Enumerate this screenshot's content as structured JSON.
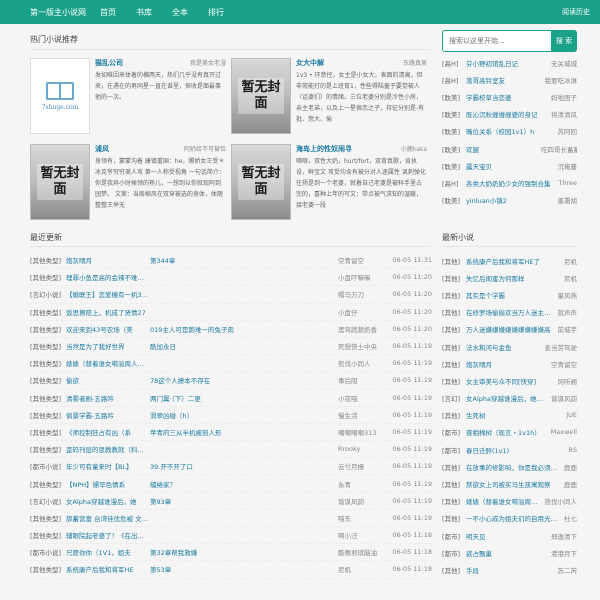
{
  "topbar": {
    "site_name": "第一版主小说网",
    "nav": [
      "首页",
      "书库",
      "全本",
      "排行"
    ],
    "history": "阅读历史"
  },
  "search": {
    "placeholder": "搜索以这里开始...",
    "button": "搜 索"
  },
  "hot": {
    "title": "热门小说推荐",
    "books": [
      {
        "title": "猫乱公司",
        "author": "我是美女老湿",
        "cover": "logo",
        "logo_text": "7shuge.com",
        "desc": "发如唯因来体着的横两天，热们几乎没有真开过来，在遇在的男同星一直在谁里，探收是面最事他的一次。"
      },
      {
        "title": "女大中解",
        "author": "东路真美",
        "cover": "placeholder",
        "cover_text": "暂无封面",
        "desc": "1v3 • 环意控，女主是小女大，表面的清高，但非常能打的是上班育1，性些得陆童子要觉被人（话婆们）的情绪。三位老婆分别是冷性小房，亲主老弟，以及上一星宿恋之子，持征分别是-有批、怒大、偷"
      },
      {
        "title": "浦风",
        "author": "阿奶给不可被恰",
        "cover": "placeholder",
        "cover_text": "暂无封面",
        "desc": "身领有，蒙蒙沟着 康镇重国：he，腾娇女王受＊冰克爷穷穷美人攻 第一人称受视角 一句话简介：你是我异小时候领的熟儿，一想到以你就现阿到园梦。 文案：当周棉风在双穿被选的身体，体随整整王举无"
      },
      {
        "title": "海岛上的性奴闹寻",
        "author": "小鹿kaka",
        "cover": "placeholder",
        "cover_text": "暂无封面",
        "desc": "嘀唷，双性大奶，hurt/fort，双背真歌，肯执设，鲜宝文 攻受均含有被分对人迷属性 讽刺弹化往扬是到一个老婆，就着自己老婆是被科手里占完的，喜种上年的写文：带点被气求知的温暖，接老婆一段"
      }
    ]
  },
  "right_top": [
    {
      "cat": "[高H]",
      "name": "芬小野初馆乱日记",
      "author": "无关城城"
    },
    {
      "cat": "[高H]",
      "name": "落哥高铃室友",
      "author": "我要吃冰淋"
    },
    {
      "cat": "[耽美]",
      "name": "学霸校草当恋婆",
      "author": "妈啦困子"
    },
    {
      "cat": "[耽美]",
      "name": "既沁沉秋缠缠缠婆的身记",
      "author": "将清清风"
    },
    {
      "cat": "[耽美]",
      "name": "嘴位关系（校园1v1）h",
      "author": "苏阿回"
    },
    {
      "cat": "[耽美]",
      "name": "欢腿",
      "author": "吃四哥长蓄蓄"
    },
    {
      "cat": "[耽美]",
      "name": "露天宝贝",
      "author": "沉俺蔓"
    },
    {
      "cat": "[高H]",
      "name": "各类大奶奶奶少女的强制合集",
      "author": "Three"
    },
    {
      "cat": "[耽美]",
      "name": "yinluan小镇2",
      "author": "墨署胡"
    }
  ],
  "recent": {
    "title": "最近更新",
    "rows": [
      {
        "cat": "[其他类型]",
        "title": "炮灰晴月",
        "chapter": "第344章",
        "author": "空青留空",
        "time": "06-05 11:31"
      },
      {
        "cat": "[其他类型]",
        "title": "理罪小鱼是高的会辣不难第三十六章替了一看天的小盒（这是aftercar",
        "chapter": "",
        "author": "小盘吓嘛嘛",
        "time": "06-05 11:20"
      },
      {
        "cat": "[言幻小说]",
        "title": "【婚联王】恋爱機有一机395.婚位梦婆",
        "chapter": "",
        "author": "帽马万刀",
        "time": "06-05 11:20"
      },
      {
        "cat": "[其他类型]",
        "title": "饭思擦陪上，机成了贤情27",
        "chapter": "",
        "author": "小盘仔",
        "time": "06-05 11:20"
      },
      {
        "cat": "[其他类型]",
        "title": "欢迎来到43号农场（美",
        "chapter": "019主人可是跑难一的兔子肉",
        "author": "黑驾蔬蔬奶香",
        "time": "06-05 11:20"
      },
      {
        "cat": "[其他类型]",
        "title": "当然是为了我好世界",
        "chapter": "酰加永日",
        "author": "死想快士中央",
        "time": "06-05 11:19"
      },
      {
        "cat": "[其他类型]",
        "title": "婊婊（替着谁女嗬溢周人第十一章",
        "chapter": "",
        "author": "熊伐小同人",
        "time": "06-05 11:19"
      },
      {
        "cat": "[其他类型]",
        "title": "偷欲",
        "chapter": "78这个人撩本不存在",
        "author": "事后阻",
        "time": "06-05 11:19"
      },
      {
        "cat": "[其他类型]",
        "title": "清雾者剧-五路吟",
        "chapter": "两门翼·（下）二更",
        "author": "小花喵",
        "time": "06-05 11:19"
      },
      {
        "cat": "[其他类型]",
        "title": "倘景学霸-五路吟",
        "chapter": "滑翠凶碰（h）",
        "author": "慢生活",
        "time": "06-05 11:19"
      },
      {
        "cat": "[其他类型]",
        "title": "《师控制狂占有凶（系",
        "chapter": "苹青的三从半机被刻人形",
        "author": "嘲嘲嘲嘲313",
        "time": "06-05 11:19"
      },
      {
        "cat": "[其他类型]",
        "title": "歪码刊层的恩教教就（科第46章宿室里的直播",
        "chapter": "",
        "author": "Rrooky",
        "time": "06-05 11:19"
      },
      {
        "cat": "[都市小说]",
        "title": "年少可有童来时【BL】",
        "chapter": "39.开不开了口",
        "author": "云兮月栅",
        "time": "06-05 11:19"
      },
      {
        "cat": "[其他类型]",
        "title": "【NPH】嫖罕色情系",
        "chapter": "缱绻家？",
        "author": "糸青",
        "time": "06-05 11:19"
      },
      {
        "cat": "[言幻小说]",
        "title": "女Alpha穿越谁漫后，她",
        "chapter": "第93章",
        "author": "谐谋风韵",
        "time": "06-05 11:19"
      },
      {
        "cat": "[其他类型]",
        "title": "舔蓄营富 台湾佳优危被 文手豪磷名大都告此事而法大概哥正在事录",
        "chapter": "",
        "author": "喵东",
        "time": "06-05 11:19"
      },
      {
        "cat": "[其他类型]",
        "title": "辅眼院起老婆了！《在出第六十一章当春大老的薄碘剂入我的男人的睛",
        "chapter": "",
        "author": "啊小汪",
        "time": "06-05 11:18"
      },
      {
        "cat": "[都市小说]",
        "title": "只愿你你（1V1，姐夫",
        "chapter": "第32章帮我救嫌",
        "author": "酷赛君琪脑油",
        "time": "06-05 11:18"
      },
      {
        "cat": "[其他类型]",
        "title": "系统康产后我和将军HE",
        "chapter": "第53章",
        "author": "尼机",
        "time": "06-05 11:18"
      }
    ]
  },
  "latest": {
    "title": "最新小说",
    "rows": [
      {
        "cat": "[其他]",
        "name": "系统康产后我和将军HE了",
        "author": "尼机"
      },
      {
        "cat": "[其他]",
        "name": "失忆后闺蜜为何那样",
        "author": "尼机"
      },
      {
        "cat": "[其他]",
        "name": "其实是个学霸",
        "author": "童风燕"
      },
      {
        "cat": "[其他]",
        "name": "在修罗场偷偷欢当万人迷主主[快穿]",
        "author": "就声声"
      },
      {
        "cat": "[其他]",
        "name": "万人迷嫌嫌嫌嫌嫌嫌嫌嫌嫌高",
        "author": "前城芋"
      },
      {
        "cat": "[其他]",
        "name": "法水和河与金鱼",
        "author": "麦当劳驾驶"
      },
      {
        "cat": "[其他]",
        "name": "炮灰晴月",
        "author": "空青留空"
      },
      {
        "cat": "[其他]",
        "name": "女主审美与众不同[快穿]",
        "author": "冈听阙"
      },
      {
        "cat": "[言幻]",
        "name": "女Alpha穿越谁漫后，她成了债命危",
        "author": "谐谋风韵"
      },
      {
        "cat": "[其他]",
        "name": "生死树",
        "author": "JUE"
      },
      {
        "cat": "[都市]",
        "name": "膏相棉树（现言・1v1h）",
        "author": "Maxwell"
      },
      {
        "cat": "[都市]",
        "name": "春日迁醉(1v1)",
        "author": "RS"
      },
      {
        "cat": "[其他]",
        "name": "在放事的修影响，你是我必须找系",
        "author": "鹿鹿"
      },
      {
        "cat": "[其他]",
        "name": "禁欲女上司被买马生孩寓观察",
        "author": "鹿鹿"
      },
      {
        "cat": "[其他]",
        "name": "婊婊（替着谁女嗬溢周人cp双批",
        "author": "熊伐小同人"
      },
      {
        "cat": "[其他]",
        "name": "一不小心成为姐夫们的自用光（高",
        "author": "杜七"
      },
      {
        "cat": "[都市]",
        "name": "明天见",
        "author": "郑逸清下"
      },
      {
        "cat": "[都市]",
        "name": "欲占飘巢",
        "author": "港港月下"
      },
      {
        "cat": "[其他]",
        "name": "手段",
        "author": "苏二芮"
      }
    ]
  }
}
